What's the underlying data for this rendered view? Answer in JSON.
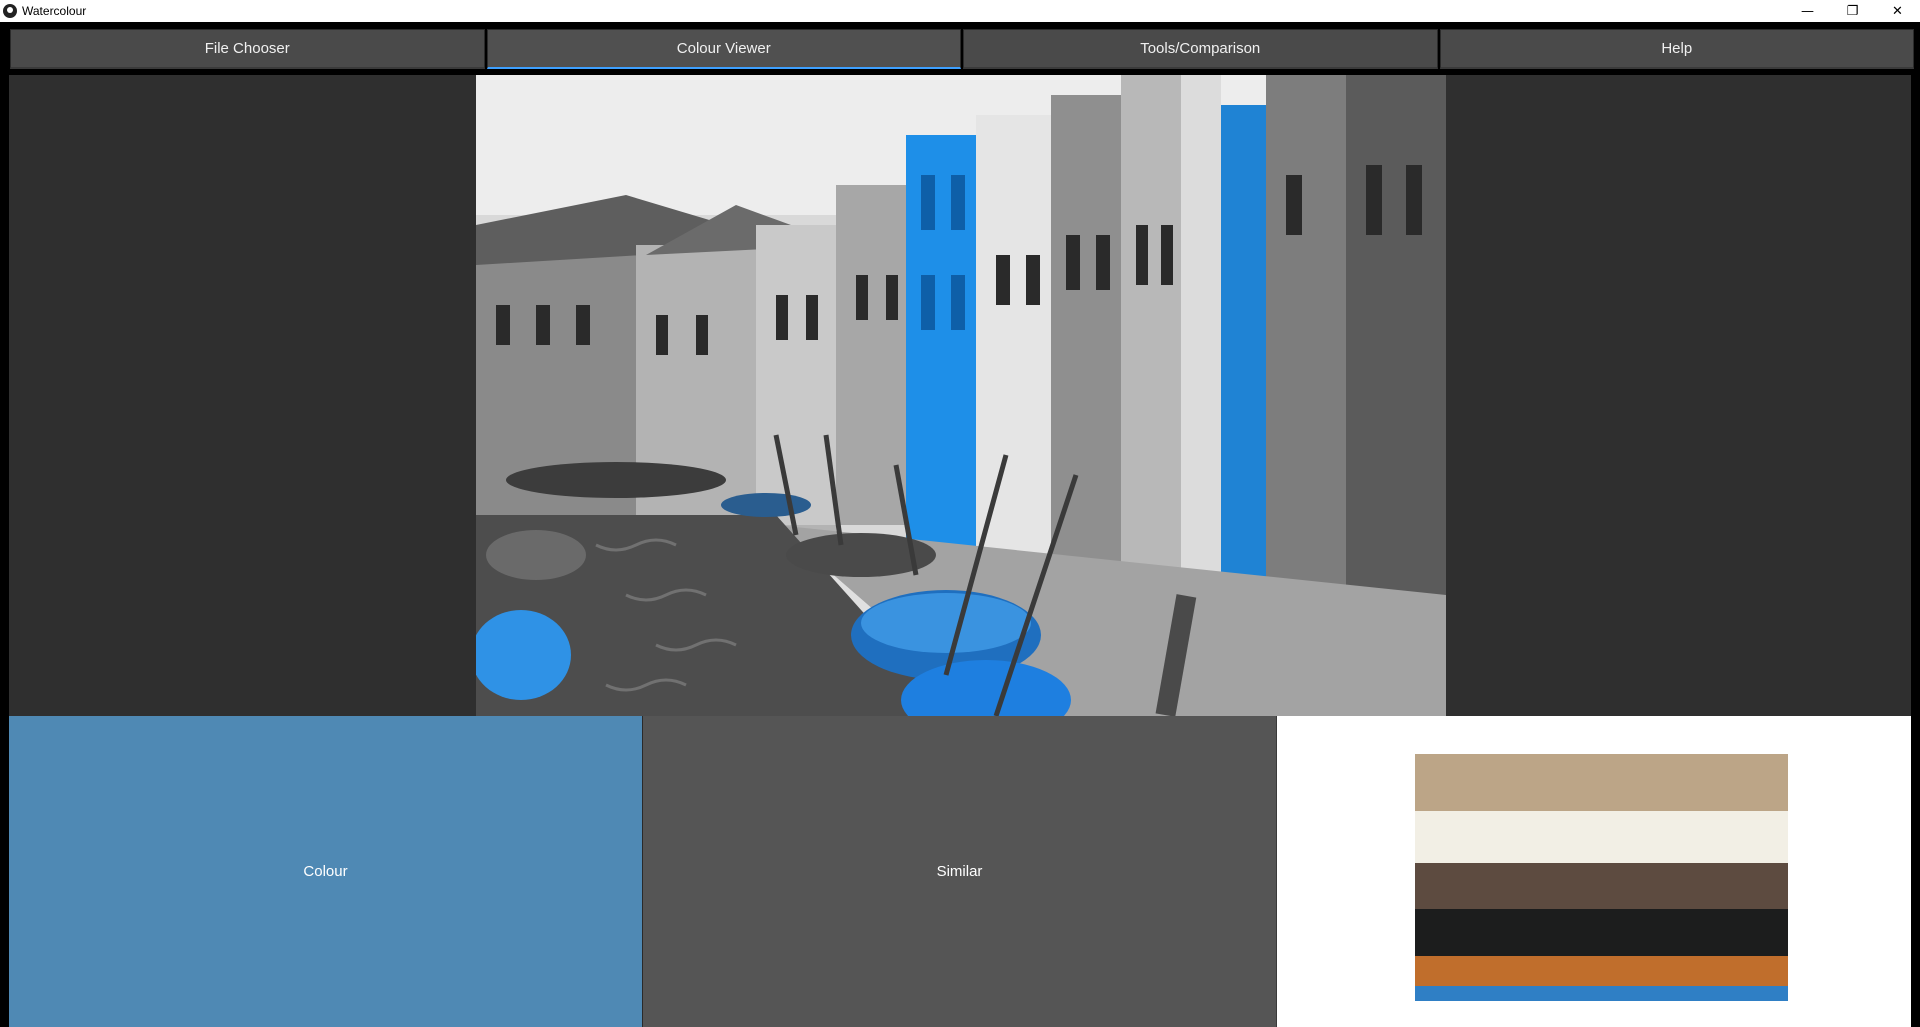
{
  "window": {
    "title": "Watercolour",
    "controls": {
      "minimize": "—",
      "restore": "❐",
      "close": "✕"
    }
  },
  "tabs": [
    {
      "label": "File Chooser",
      "active": false
    },
    {
      "label": "Colour Viewer",
      "active": true
    },
    {
      "label": "Tools/Comparison",
      "active": false
    },
    {
      "label": "Help",
      "active": false
    }
  ],
  "viewer": {
    "image_description": "black-and-white canal street with boats and a few houses highlighted in blue"
  },
  "bottom": {
    "colour_label": "Colour",
    "similar_label": "Similar",
    "selected_colour": "#4f89b4"
  },
  "palette": {
    "swatches": [
      {
        "color": "#bca587",
        "share": 0.23
      },
      {
        "color": "#f2efe5",
        "share": 0.21
      },
      {
        "color": "#5d4b40",
        "share": 0.19
      },
      {
        "color": "#1c1d1d",
        "share": 0.19
      },
      {
        "color": "#c06e2c",
        "share": 0.12
      },
      {
        "color": "#2f7fc5",
        "share": 0.06
      }
    ]
  }
}
